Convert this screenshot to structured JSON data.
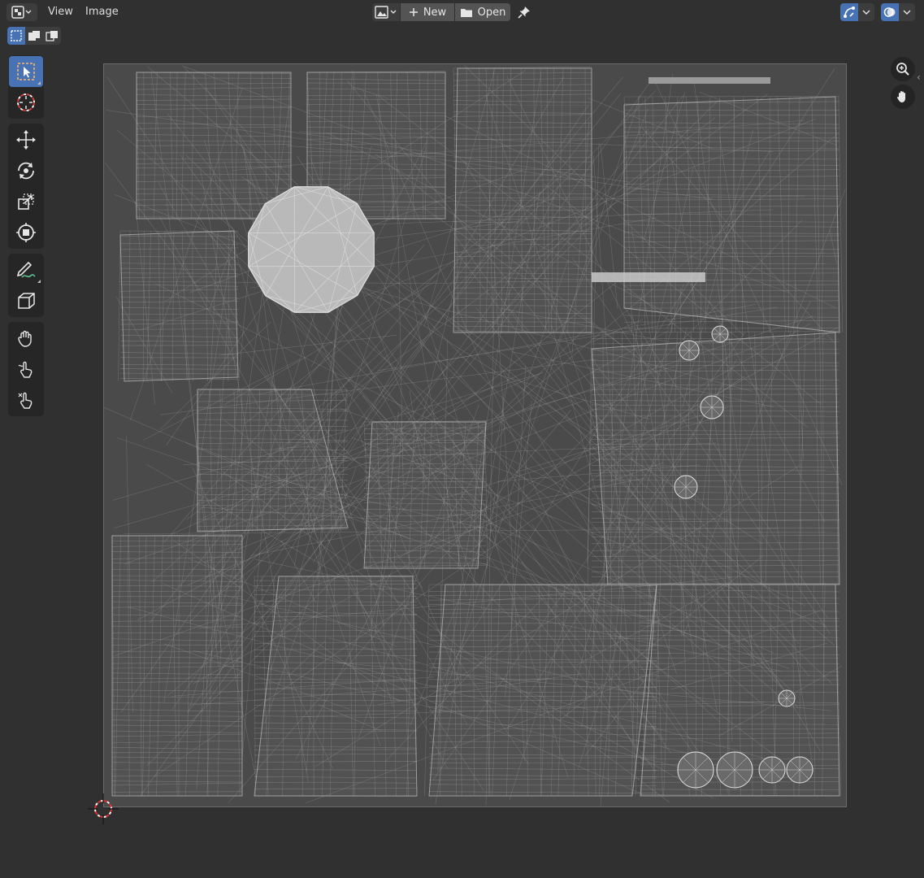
{
  "header": {
    "editor_type_icon": "image-editor-icon",
    "menus": [
      "View",
      "Image"
    ],
    "image_browse_icon": "image-browse-icon",
    "new_label": "New",
    "open_label": "Open",
    "pin_icon": "pin-icon",
    "gizmo_icon": "gizmo-toggle-icon",
    "overlay_icon": "overlay-toggle-icon"
  },
  "select_modes": [
    "select-new-icon",
    "select-extend-icon",
    "select-subtract-icon"
  ],
  "toolbar": {
    "groups": [
      [
        "select-box-icon",
        "cursor-icon"
      ],
      [
        "move-icon",
        "rotate-icon",
        "scale-icon",
        "transform-icon"
      ],
      [
        "annotate-icon",
        "cube-project-icon"
      ],
      [
        "grab-icon",
        "relax-icon",
        "pinch-icon"
      ]
    ],
    "active_tool": "select-box-icon"
  },
  "navigation": [
    "zoom-icon",
    "pan-hand-icon"
  ],
  "colors": {
    "background": "#303030",
    "accent": "#4772b3",
    "uv_grid": "#4a4a4a",
    "wire": "#bdbdbd"
  }
}
